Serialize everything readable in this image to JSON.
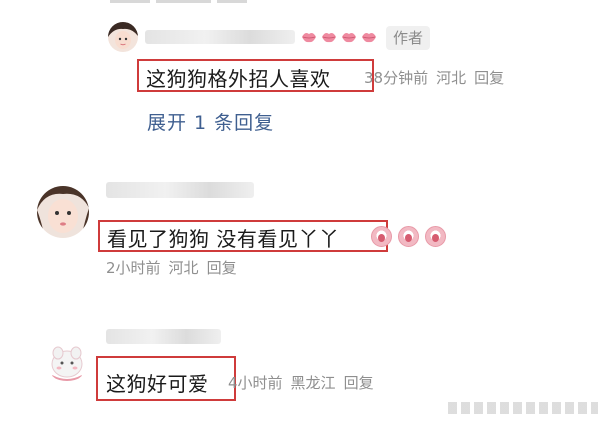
{
  "comments": [
    {
      "author_tag": "作者",
      "text": "这狗狗格外招人喜欢",
      "time": "38分钟前",
      "location": "河北",
      "reply_label": "回复",
      "expand_label": "展开 1 条回复"
    },
    {
      "text": "看见了狗狗 没有看见丫丫",
      "time": "2小时前",
      "location": "河北",
      "reply_label": "回复"
    },
    {
      "text": "这狗好可爱",
      "time": "4小时前",
      "location": "黑龙江",
      "reply_label": "回复"
    }
  ],
  "icons": {
    "reaction": "lips-icon",
    "emoji": "crying-face-icon"
  },
  "colors": {
    "highlight_border": "#cf3b3b",
    "link": "#3f5f90",
    "meta": "#8f8f8f"
  }
}
